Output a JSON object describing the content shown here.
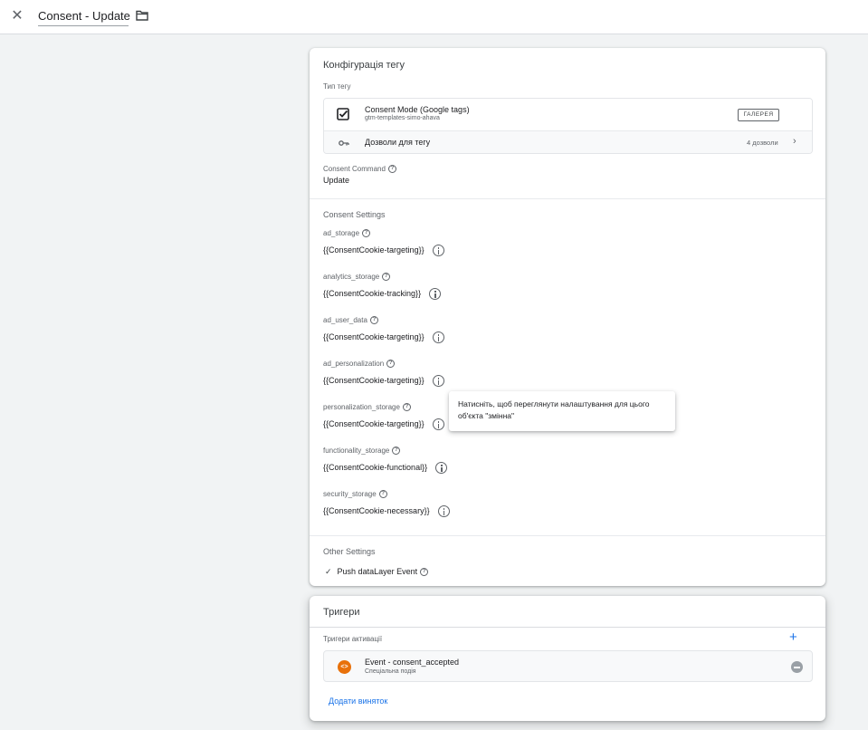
{
  "header": {
    "close_icon": "close-icon",
    "title": "Consent - Update",
    "folder_icon": "folder-icon"
  },
  "config": {
    "title": "Конфігурація тегу",
    "tag_type_label": "Тип тегу",
    "tag_type": {
      "icon": "checkbox-checked-icon",
      "name": "Consent Mode (Google tags)",
      "subtitle": "gtm-templates-simo-ahava",
      "gallery_label": "ГАЛЕРЕЯ"
    },
    "permissions": {
      "icon": "key-icon",
      "label": "Дозволи для тегу",
      "count": "4 дозволи"
    },
    "consent_command": {
      "label": "Consent Command",
      "value": "Update"
    },
    "consent_settings_title": "Consent Settings",
    "fields": [
      {
        "label": "ad_storage",
        "value": "{{ConsentCookie-targeting}}"
      },
      {
        "label": "analytics_storage",
        "value": "{{ConsentCookie-tracking}}"
      },
      {
        "label": "ad_user_data",
        "value": "{{ConsentCookie-targeting}}"
      },
      {
        "label": "ad_personalization",
        "value": "{{ConsentCookie-targeting}}"
      },
      {
        "label": "personalization_storage",
        "value": "{{ConsentCookie-targeting}}"
      },
      {
        "label": "functionality_storage",
        "value": "{{ConsentCookie-functional}}"
      },
      {
        "label": "security_storage",
        "value": "{{ConsentCookie-necessary}}"
      }
    ],
    "other_settings_title": "Other Settings",
    "push_datalayer": {
      "checked": true,
      "label": "Push dataLayer Event"
    }
  },
  "tooltip": {
    "text": "Натисніть, щоб переглянути налаштування для цього об'єкта \"змінна\""
  },
  "triggers": {
    "title": "Тригери",
    "firing_label": "Тригери активації",
    "items": [
      {
        "icon": "code-icon",
        "name": "Event - consent_accepted",
        "type": "Спеціальна подія"
      }
    ],
    "add_exception_label": "Додати виняток",
    "accent_color": "#1a73e8",
    "event_icon_color": "#e8710a"
  }
}
